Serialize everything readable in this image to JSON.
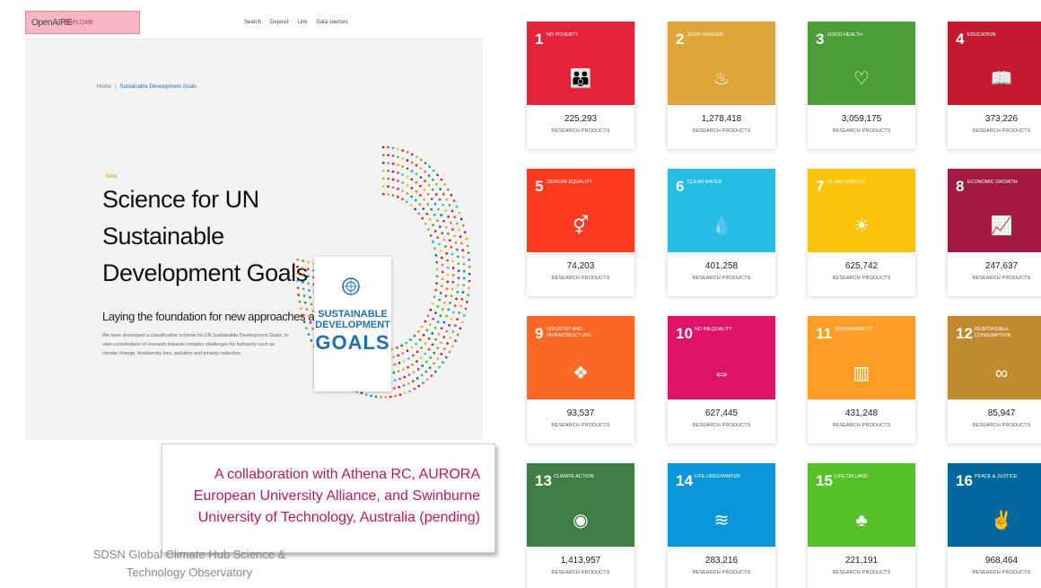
{
  "openaire": {
    "logo": "OpenAIRE",
    "logo_tag": "EXPLORE",
    "nav": [
      "Search",
      "Deposit",
      "Link",
      "Data sources"
    ],
    "breadcrumb": {
      "home": "Home",
      "current": "Sustainable Development Goals"
    },
    "beta": "Beta",
    "title": "Science for UN Sustainable Development Goals",
    "subtitle": "Laying the foundation for new approaches and solutions.",
    "description": "We have developed a classification scheme for UN Sustainable Development Goals, to view contributions of research towards complex challenges for humanity such as climate change, biodiversity loss, pollution and poverty reduction.",
    "sdg_logo": {
      "line1": "SUSTAINABLE",
      "line2": "DEVELOPMENT",
      "line3": "GOALS"
    }
  },
  "collaboration": "A collaboration with Athena RC, AURORA European University Alliance, and Swinburne University of Technology, Australia (pending)",
  "caption": "SDSN Global Climate Hub Science & Technology Observatory",
  "products_label": "RESEARCH PRODUCTS",
  "sdgs": [
    {
      "num": "1",
      "label": "No poverty",
      "count": "225,293",
      "color": "#e5243b",
      "icon": "people-icon",
      "glyph": "👪"
    },
    {
      "num": "2",
      "label": "Zero hunger",
      "count": "1,278,418",
      "color": "#dda63a",
      "icon": "bowl-icon",
      "glyph": "♨"
    },
    {
      "num": "3",
      "label": "Good health",
      "count": "3,059,175",
      "color": "#4c9f38",
      "icon": "heartbeat-icon",
      "glyph": "♡"
    },
    {
      "num": "4",
      "label": "Education",
      "count": "373,226",
      "color": "#c5192d",
      "icon": "book-icon",
      "glyph": "📖"
    },
    {
      "num": "5",
      "label": "Gender equality",
      "count": "74,203",
      "color": "#ff3a21",
      "icon": "gender-icon",
      "glyph": "⚥"
    },
    {
      "num": "6",
      "label": "Clean water",
      "count": "401,258",
      "color": "#26bde2",
      "icon": "water-icon",
      "glyph": "💧"
    },
    {
      "num": "7",
      "label": "Clean energy",
      "count": "625,742",
      "color": "#fcc30b",
      "icon": "sun-icon",
      "glyph": "☀"
    },
    {
      "num": "8",
      "label": "Economic growth",
      "count": "247,637",
      "color": "#a21942",
      "icon": "growth-chart-icon",
      "glyph": "📈"
    },
    {
      "num": "9",
      "label": "Industry and infrastructure",
      "count": "93,537",
      "color": "#fd6925",
      "icon": "cubes-icon",
      "glyph": "❖"
    },
    {
      "num": "10",
      "label": "No inequality",
      "count": "627,445",
      "color": "#dd1367",
      "icon": "equality-icon",
      "glyph": "⇔"
    },
    {
      "num": "11",
      "label": "Sustainability",
      "count": "431,248",
      "color": "#fd9d24",
      "icon": "city-icon",
      "glyph": "▥"
    },
    {
      "num": "12",
      "label": "Responsible consumption",
      "count": "85,947",
      "color": "#bf8b2e",
      "icon": "infinity-icon",
      "glyph": "∞"
    },
    {
      "num": "13",
      "label": "Climate action",
      "count": "1,413,957",
      "color": "#3f7e44",
      "icon": "eye-globe-icon",
      "glyph": "◉"
    },
    {
      "num": "14",
      "label": "Life underwater",
      "count": "283,216",
      "color": "#0a97d9",
      "icon": "fish-icon",
      "glyph": "≋"
    },
    {
      "num": "15",
      "label": "Life on land",
      "count": "221,191",
      "color": "#56c02b",
      "icon": "tree-icon",
      "glyph": "♣"
    },
    {
      "num": "16",
      "label": "Peace & justice",
      "count": "968,464",
      "color": "#00689d",
      "icon": "dove-icon",
      "glyph": "✌"
    }
  ]
}
